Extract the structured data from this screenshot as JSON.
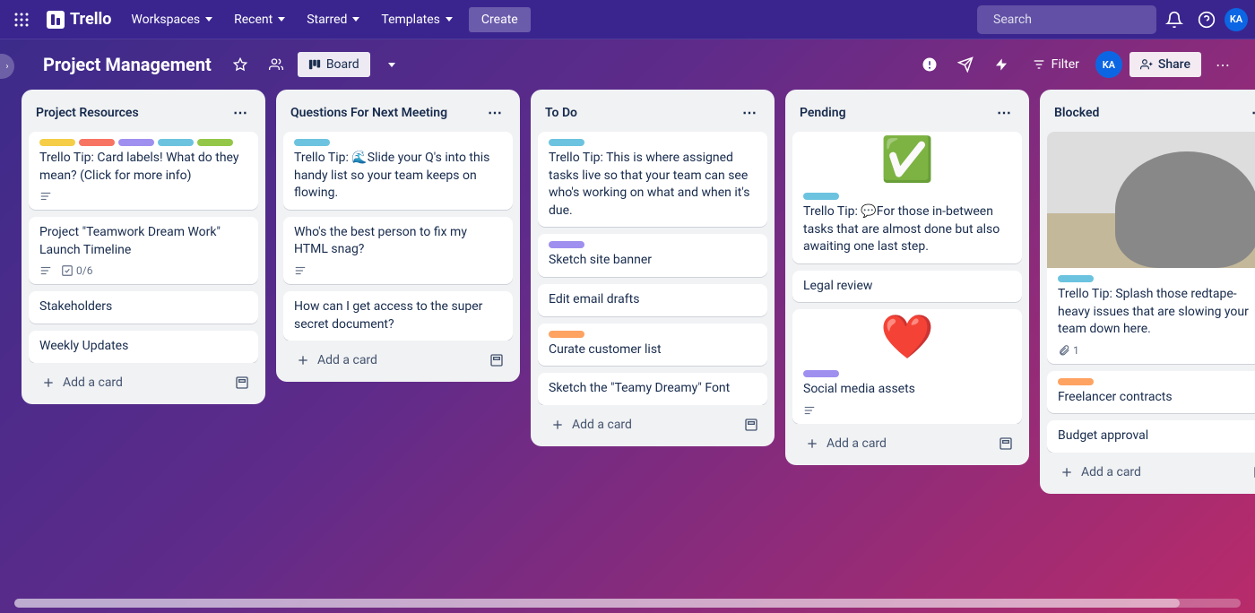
{
  "header": {
    "logo_text": "Trello",
    "nav": {
      "workspaces": "Workspaces",
      "recent": "Recent",
      "starred": "Starred",
      "templates": "Templates"
    },
    "create": "Create",
    "search_placeholder": "Search",
    "avatar": "KA"
  },
  "board": {
    "title": "Project Management",
    "view": "Board",
    "filter": "Filter",
    "share": "Share"
  },
  "add_card_label": "Add a card",
  "lists": [
    {
      "title": "Project Resources",
      "cards": [
        {
          "labels": [
            "yellow",
            "red",
            "purple",
            "sky",
            "lime"
          ],
          "text": "Trello Tip: Card labels! What do they mean? (Click for more info)",
          "desc": true
        },
        {
          "text": "Project \"Teamwork Dream Work\" Launch Timeline",
          "desc": true,
          "checklist": "0/6"
        },
        {
          "text": "Stakeholders"
        },
        {
          "text": "Weekly Updates"
        }
      ]
    },
    {
      "title": "Questions For Next Meeting",
      "cards": [
        {
          "labels": [
            "sky"
          ],
          "text": "Trello Tip: 🌊Slide your Q's into this handy list so your team keeps on flowing."
        },
        {
          "text": "Who's the best person to fix my HTML snag?",
          "desc": true
        },
        {
          "text": "How can I get access to the super secret document?"
        }
      ]
    },
    {
      "title": "To Do",
      "cards": [
        {
          "labels": [
            "sky"
          ],
          "text": "Trello Tip: This is where assigned tasks live so that your team can see who's working on what and when it's due."
        },
        {
          "labels": [
            "purple"
          ],
          "text": "Sketch site banner"
        },
        {
          "text": "Edit email drafts"
        },
        {
          "labels": [
            "orange"
          ],
          "text": "Curate customer list"
        },
        {
          "text": "Sketch the \"Teamy Dreamy\" Font"
        }
      ]
    },
    {
      "title": "Pending",
      "cards": [
        {
          "cover": "check",
          "labels": [
            "sky"
          ],
          "text": "Trello Tip: 💬For those in-between tasks that are almost done but also awaiting one last step."
        },
        {
          "text": "Legal review"
        },
        {
          "cover": "heart",
          "labels": [
            "purple"
          ],
          "text": "Social media assets",
          "desc": true
        }
      ]
    },
    {
      "title": "Blocked",
      "cards": [
        {
          "cover": "cat",
          "labels": [
            "sky"
          ],
          "text": "Trello Tip: Splash those redtape-heavy issues that are slowing your team down here.",
          "attach": "1"
        },
        {
          "labels": [
            "orange"
          ],
          "text": "Freelancer contracts"
        },
        {
          "text": "Budget approval"
        }
      ]
    }
  ]
}
